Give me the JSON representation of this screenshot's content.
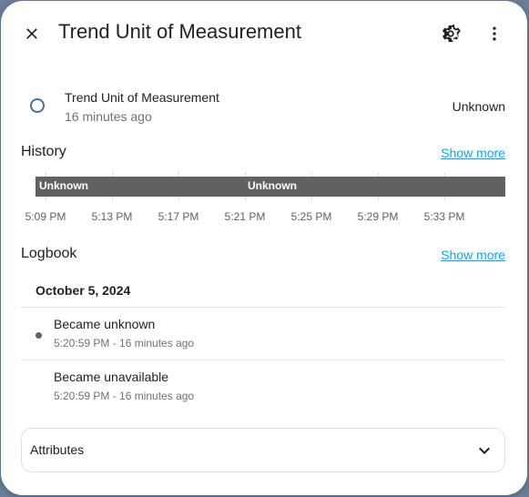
{
  "header": {
    "title": "Trend Unit of Measurement",
    "close_icon": "close-icon",
    "settings_icon": "gear-icon",
    "menu_icon": "more-vertical-icon"
  },
  "entity": {
    "name": "Trend Unit of Measurement",
    "last_changed": "16 minutes ago",
    "state": "Unknown",
    "state_color": "#44739e"
  },
  "history": {
    "title": "History",
    "show_more": "Show more",
    "bar_color": "#616161",
    "segments": [
      "Unknown",
      "Unknown"
    ],
    "ticks": [
      "5:09 PM",
      "5:13 PM",
      "5:17 PM",
      "5:21 PM",
      "5:25 PM",
      "5:29 PM",
      "5:33 PM"
    ]
  },
  "logbook": {
    "title": "Logbook",
    "show_more": "Show more",
    "date": "October 5, 2024",
    "entries": [
      {
        "message": "Became unknown",
        "time": "5:20:59 PM - 16 minutes ago"
      },
      {
        "message": "Became unavailable",
        "time": "5:20:59 PM - 16 minutes ago"
      }
    ]
  },
  "attributes": {
    "label": "Attributes",
    "icon": "chevron-down-icon"
  },
  "colors": {
    "link": "#03a9f4",
    "background": "#ffffff"
  }
}
